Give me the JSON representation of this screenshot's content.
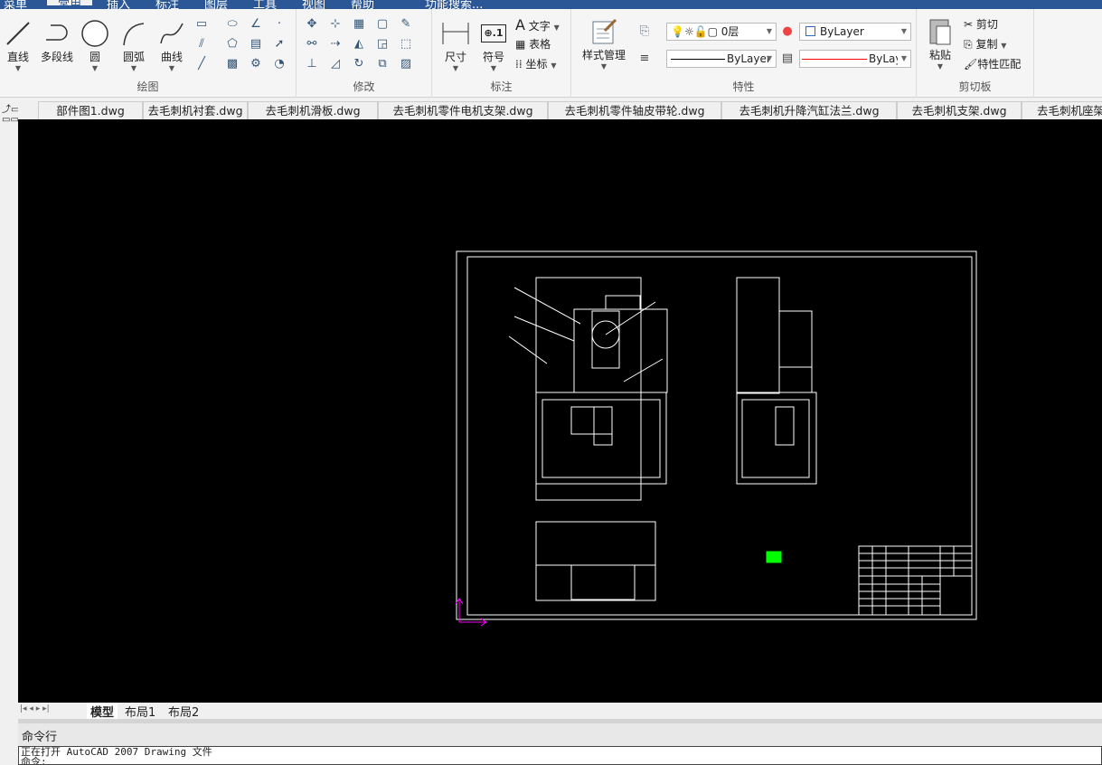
{
  "menu": {
    "tabs": [
      "菜单",
      "常用",
      "插入",
      "标注",
      "图层",
      "工具",
      "视图",
      "帮助",
      "功能搜索..."
    ],
    "active": 1
  },
  "ribbon": {
    "draw": {
      "label": "绘图",
      "items": [
        "直线",
        "多段线",
        "圆",
        "圆弧",
        "曲线"
      ]
    },
    "modify": {
      "label": "修改"
    },
    "annotate": {
      "label": "标注",
      "dimension": "尺寸",
      "symbol": "符号",
      "text": "文字",
      "table": "表格",
      "coordinate": "坐标"
    },
    "properties": {
      "label": "特性",
      "style_manager": "样式管理",
      "layer": "0层",
      "color": "ByLayer",
      "linetype": "ByLayer",
      "lineweight": "ByLayer",
      "accent_line": "#ff0000"
    },
    "clipboard": {
      "label": "剪切板",
      "paste": "粘贴",
      "cut": "剪切",
      "copy": "复制",
      "match": "特性匹配"
    }
  },
  "file_tabs": [
    "部件图1.dwg",
    "去毛刺机衬套.dwg",
    "去毛刺机滑板.dwg",
    "去毛刺机零件电机支架.dwg",
    "去毛刺机零件轴皮带轮.dwg",
    "去毛刺机升降汽缸法兰.dwg",
    "去毛刺机支架.dwg",
    "去毛刺机座架"
  ],
  "layout_tabs": [
    "模型",
    "布局1",
    "布局2"
  ],
  "command": {
    "title": "命令行",
    "lines": [
      "正在打开 AutoCAD 2007 Drawing 文件",
      "命令:"
    ]
  },
  "colors": {
    "menubar": "#2b5797",
    "canvas": "#000000",
    "ucs": "#ff00ff",
    "highlight": "#00ff00"
  }
}
